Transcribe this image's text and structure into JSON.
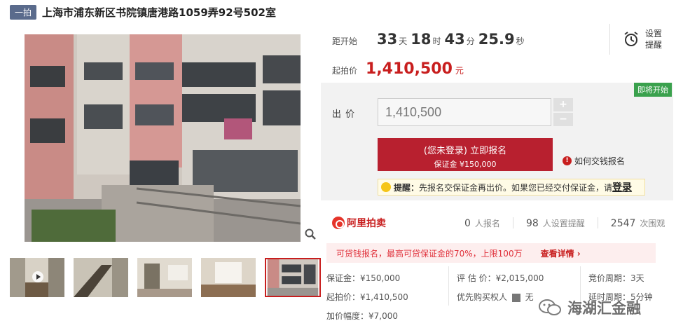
{
  "header": {
    "badge": "一拍",
    "title": "上海市浦东新区书院镇唐港路1059弄92号502室"
  },
  "countdown": {
    "label": "距开始",
    "days": "33",
    "days_unit": "天",
    "hours": "18",
    "hours_unit": "时",
    "minutes": "43",
    "minutes_unit": "分",
    "seconds": "25.9",
    "seconds_unit": "秒"
  },
  "reminder": {
    "label": "设置提醒"
  },
  "starting": {
    "label": "起拍价",
    "price": "1,410,500",
    "unit": "元"
  },
  "bid": {
    "status_tag": "即将开始",
    "label": "出价",
    "value": "1,410,500",
    "plus": "+",
    "minus": "−",
    "signup_main": "(您未登录) 立即报名",
    "signup_sub": "保证金 ¥150,000",
    "howto_icon": "!",
    "howto": "如何交钱报名",
    "tip_prefix": "提醒：",
    "tip_body": "先报名交保证金再出价。如果您已经交付保证金，请",
    "tip_login": "登录"
  },
  "platform": {
    "logo_text": "阿里拍卖",
    "signups": "0",
    "signups_unit": "人报名",
    "reminders": "98",
    "reminders_unit": "人设置提醒",
    "views": "2547",
    "views_unit": "次围观"
  },
  "loan": {
    "text": "可贷钱报名，最高可贷保证金的70%，上限100万",
    "link": "查看详情"
  },
  "details": {
    "deposit": "保证金：¥150,000",
    "start_price": "起拍价：¥1,410,500",
    "increment": "加价幅度：¥7,000",
    "appraisal": "评 估 价：¥2,015,000",
    "priority_label": "优先购买权人",
    "priority_value": "无",
    "cycle": "竞价周期：3天",
    "extension": "延时周期：5分钟"
  },
  "watermark": {
    "text": "海湖汇金融"
  },
  "colors": {
    "accent": "#c81e1e",
    "badge": "#5a6b8c",
    "soon": "#3aa14d"
  },
  "icons": [
    "alarm-clock-icon",
    "zoom-icon",
    "play-icon",
    "info-icon",
    "bulb-icon",
    "alibaba-logo-icon",
    "chevron-right-icon",
    "wechat-icon"
  ]
}
